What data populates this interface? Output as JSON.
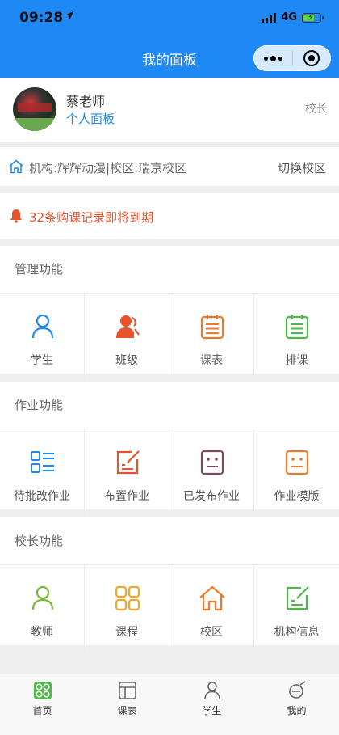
{
  "status_bar": {
    "time": "09:28",
    "network": "4G"
  },
  "nav": {
    "title": "我的面板"
  },
  "profile": {
    "name": "蔡老师",
    "link": "个人面板",
    "role": "校长"
  },
  "org": {
    "text": "机构:辉辉动漫|校区:瑞京校区",
    "switch_label": "切换校区"
  },
  "alert": {
    "text": "32条购课记录即将到期"
  },
  "colors": {
    "primary": "#1e88f5",
    "alert": "#e8532c",
    "blue": "#1e88f5",
    "red": "#e8532c",
    "orange": "#f07a2c",
    "green": "#4fb84a",
    "purple": "#7a4a63",
    "yellow": "#f5a623",
    "lime": "#7ab83a"
  },
  "sections": [
    {
      "title": "管理功能",
      "items": [
        {
          "label": "学生",
          "icon": "user-icon"
        },
        {
          "label": "班级",
          "icon": "class-icon"
        },
        {
          "label": "课表",
          "icon": "calendar-icon"
        },
        {
          "label": "排课",
          "icon": "schedule-icon"
        }
      ]
    },
    {
      "title": "作业功能",
      "items": [
        {
          "label": "待批改作业",
          "icon": "list-icon"
        },
        {
          "label": "布置作业",
          "icon": "edit-icon"
        },
        {
          "label": "已发布作业",
          "icon": "document-icon"
        },
        {
          "label": "作业模版",
          "icon": "template-icon"
        }
      ]
    },
    {
      "title": "校长功能",
      "items": [
        {
          "label": "教师",
          "icon": "teacher-icon"
        },
        {
          "label": "课程",
          "icon": "grid-icon"
        },
        {
          "label": "校区",
          "icon": "house-icon"
        },
        {
          "label": "机构信息",
          "icon": "info-edit-icon"
        }
      ]
    }
  ],
  "tabs": [
    {
      "label": "首页",
      "icon": "home-icon"
    },
    {
      "label": "课表",
      "icon": "timetable-icon"
    },
    {
      "label": "学生",
      "icon": "student-icon"
    },
    {
      "label": "我的",
      "icon": "mine-icon"
    }
  ]
}
